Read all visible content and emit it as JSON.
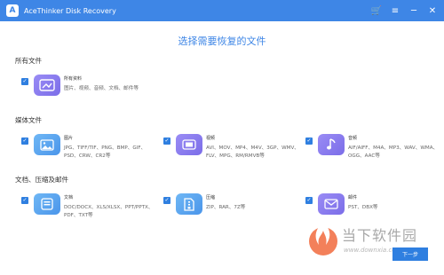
{
  "app": {
    "title": "AceThinker Disk Recovery",
    "logo_char": "A"
  },
  "window_controls": {
    "cart": "🛒",
    "menu": "≡",
    "minimize": "─",
    "close": "✕"
  },
  "page_title": "选择需要恢复的文件",
  "sections": {
    "all": {
      "title": "所有文件",
      "items": [
        {
          "name": "所有资料",
          "desc": "图片、视频、音频、文档、邮件等"
        }
      ]
    },
    "media": {
      "title": "媒体文件",
      "items": [
        {
          "name": "图片",
          "desc": "JPG、TIFF/TIF、PNG、BMP、GIF、PSD、CRW、CR2等"
        },
        {
          "name": "视频",
          "desc": "AVI、MOV、MP4、M4V、3GP、WMV、FLV、MPG、RM/RMVB等"
        },
        {
          "name": "音频",
          "desc": "AIF/AIFF、M4A、MP3、WAV、WMA、OGG、AAC等"
        }
      ]
    },
    "docs": {
      "title": "文档、压缩及邮件",
      "items": [
        {
          "name": "文档",
          "desc": "DOC/DOCX、XLS/XLSX、PPT/PPTX、PDF、TXT等"
        },
        {
          "name": "压缩",
          "desc": "ZIP、RAR、7Z等"
        },
        {
          "name": "邮件",
          "desc": "PST、DBX等"
        }
      ]
    }
  },
  "checkbox_mark": "✓",
  "next_button": "下一步",
  "watermark": {
    "text": "当下软件园",
    "url": "www.downxia.com"
  },
  "colors": {
    "accent": "#3e86e6",
    "purple_icon": "#8a7ff0",
    "blue_icon": "#5aa7f0"
  }
}
